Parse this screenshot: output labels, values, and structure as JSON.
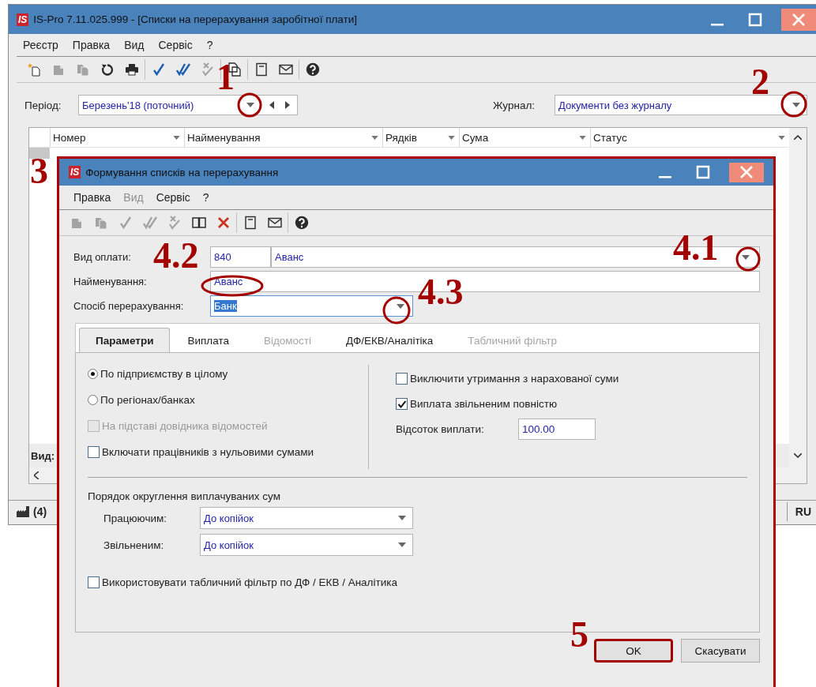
{
  "window": {
    "logo": "IS",
    "title": "IS-Pro 7.11.025.999 - [Списки на перерахування заробітної плати]"
  },
  "menu": [
    "Реєстр",
    "Правка",
    "Вид",
    "Сервіс",
    "?"
  ],
  "toolbar": [
    [
      {
        "kind": "new",
        "disabled": false
      },
      {
        "kind": "document",
        "disabled": true
      },
      {
        "kind": "documents",
        "disabled": true
      },
      {
        "kind": "refresh",
        "disabled": false
      },
      {
        "kind": "print",
        "disabled": false
      }
    ],
    [
      {
        "kind": "check",
        "disabled": false
      },
      {
        "kind": "double-check",
        "disabled": false
      },
      {
        "kind": "check-cross",
        "disabled": true
      }
    ],
    [
      {
        "kind": "copy",
        "disabled": false
      }
    ],
    [
      {
        "kind": "note",
        "disabled": false
      },
      {
        "kind": "mail",
        "disabled": false
      }
    ],
    [
      {
        "kind": "help",
        "disabled": false
      }
    ]
  ],
  "period": {
    "label": "Період:",
    "value": "Березень'18 (поточний)",
    "annotation": "1",
    "circled": true
  },
  "journal": {
    "label": "Журнал:",
    "value": "Документи без журналу",
    "annotation": "2",
    "circled": true
  },
  "table": {
    "columns": [
      "Номер",
      "Найменування",
      "Рядків",
      "Сума",
      "Статус"
    ],
    "footer_label": "Вид:"
  },
  "status_bar": {
    "count": "(4)",
    "language": "RU"
  },
  "dialog": {
    "logo": "IS",
    "title": "Формування списків на перерахування",
    "annotation": "3",
    "menu": [
      {
        "label": "Правка",
        "disabled": false
      },
      {
        "label": "Вид",
        "disabled": true
      },
      {
        "label": "Сервіс",
        "disabled": false
      },
      {
        "label": "?",
        "disabled": false
      }
    ],
    "toolbar": [
      [
        {
          "kind": "document",
          "disabled": true
        },
        {
          "kind": "documents",
          "disabled": true
        },
        {
          "kind": "check",
          "disabled": true
        },
        {
          "kind": "double-check",
          "disabled": true
        },
        {
          "kind": "check-cross",
          "disabled": true
        },
        {
          "kind": "book",
          "disabled": false
        },
        {
          "kind": "delete",
          "disabled": false
        }
      ],
      [
        {
          "kind": "note",
          "disabled": false
        },
        {
          "kind": "mail",
          "disabled": false
        }
      ],
      [
        {
          "kind": "help",
          "disabled": false
        }
      ]
    ],
    "payment_type": {
      "label": "Вид оплати:",
      "code": "840",
      "value": "Аванс",
      "annotation": "4.1",
      "circled": true
    },
    "name": {
      "label": "Найменування:",
      "value": "Аванс",
      "annotation": "4.2",
      "circled": true
    },
    "method": {
      "label": "Спосіб перерахування:",
      "value": "Банк",
      "annotation": "4.3",
      "circled": true
    },
    "tabs": [
      {
        "label": "Параметри",
        "selected": true,
        "disabled": false
      },
      {
        "label": "Виплата",
        "selected": false,
        "disabled": false
      },
      {
        "label": "Відомості",
        "selected": false,
        "disabled": true
      },
      {
        "label": "ДФ/ЕКВ/Аналітіка",
        "selected": false,
        "disabled": false
      },
      {
        "label": "Табличний фільтр",
        "selected": false,
        "disabled": true
      }
    ],
    "scope": [
      {
        "label": "По підприємству в цілому",
        "selected": true
      },
      {
        "label": "По регіонах/банках",
        "selected": false
      }
    ],
    "left_options": [
      {
        "label": "На підставі довідника відомостей",
        "checked": false,
        "disabled": true
      },
      {
        "label": "Включати працівників з нульовими сумами",
        "checked": false,
        "disabled": false
      }
    ],
    "right_options": [
      {
        "label": "Виключити утримання з нарахованої суми",
        "checked": false
      },
      {
        "label": "Виплата звільненим повністю",
        "checked": true
      }
    ],
    "percent": {
      "label": "Відсоток виплати:",
      "value": "100.00"
    },
    "rounding": {
      "title": "Порядок округлення виплачуваних сум",
      "rows": [
        {
          "label": "Працюючим:",
          "value": "До копійок"
        },
        {
          "label": "Звільненим:",
          "value": "До копійок"
        }
      ]
    },
    "table_filter": {
      "label": "Використовувати табличний фільтр по ДФ / ЕКВ / Аналітика",
      "checked": false
    },
    "buttons": [
      {
        "label": "OK",
        "highlighted": true,
        "annotation": "5"
      },
      {
        "label": "Скасувати",
        "highlighted": false
      }
    ]
  }
}
